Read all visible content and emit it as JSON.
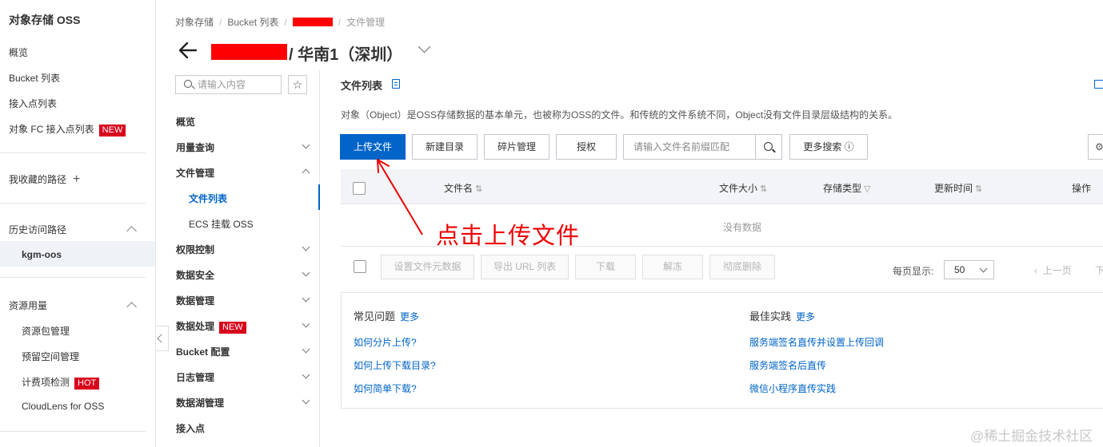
{
  "sidebar": {
    "title": "对象存储 OSS",
    "items": [
      {
        "label": "概览"
      },
      {
        "label": "Bucket 列表"
      },
      {
        "label": "接入点列表"
      },
      {
        "label": "对象 FC 接入点列表",
        "badge": "NEW"
      }
    ],
    "favorites_label": "我收藏的路径",
    "history_label": "历史访问路径",
    "history_items": [
      {
        "label": "kgm-oos"
      }
    ],
    "resources_label": "资源用量",
    "resource_items": [
      {
        "label": "资源包管理"
      },
      {
        "label": "预留空间管理"
      },
      {
        "label": "计费项检测",
        "badge": "HOT"
      },
      {
        "label": "CloudLens for OSS"
      }
    ]
  },
  "breadcrumb": {
    "items": [
      "对象存储",
      "Bucket 列表"
    ],
    "last": "文件管理"
  },
  "header": {
    "title": "/ 华南1（深圳）"
  },
  "subnav": {
    "search_placeholder": "请输入内容",
    "star": "☆",
    "items": [
      {
        "label": "概览"
      },
      {
        "label": "用量查询"
      },
      {
        "label": "文件管理"
      },
      {
        "label": "文件列表",
        "active": true
      },
      {
        "label": "ECS 挂载 OSS"
      },
      {
        "label": "权限控制"
      },
      {
        "label": "数据安全"
      },
      {
        "label": "数据管理"
      },
      {
        "label": "数据处理",
        "badge": "NEW"
      },
      {
        "label": "Bucket 配置"
      },
      {
        "label": "日志管理"
      },
      {
        "label": "数据湖管理"
      },
      {
        "label": "接入点"
      }
    ]
  },
  "main": {
    "section_title": "文件列表",
    "description": "对象（Object）是OSS存储数据的基本单元，也被称为OSS的文件。和传统的文件系统不同，Object没有文件目录层级结构的关系。",
    "toolbar": {
      "upload": "上传文件",
      "new_dir": "新建目录",
      "fragments": "碎片管理",
      "authorize": "授权",
      "filter_placeholder": "请输入文件名前缀匹配",
      "more_search": "更多搜索 ⓘ"
    },
    "table": {
      "columns": {
        "name": "文件名",
        "size": "文件大小",
        "storage": "存储类型",
        "updated": "更新时间",
        "ops": "操作"
      },
      "empty": "没有数据"
    },
    "bulk_actions": {
      "set_meta": "设置文件元数据",
      "export_url": "导出 URL 列表",
      "download": "下载",
      "unfreeze": "解冻",
      "delete": "彻底删除"
    },
    "pagination": {
      "per_page_label": "每页显示:",
      "per_page_value": "50",
      "prev": "上一页",
      "next_fragment": "下"
    },
    "help": {
      "faq_title": "常见问题",
      "faq_more": "更多",
      "faq_links": [
        "如何分片上传?",
        "如何上传下载目录?",
        "如何简单下载?"
      ],
      "best_title": "最佳实践",
      "best_more": "更多",
      "best_links": [
        "服务端签名直传并设置上传回调",
        "服务端签名后直传",
        "微信小程序直传实践"
      ]
    }
  },
  "annotation": {
    "text": "点击上传文件",
    "color": "#e00000"
  },
  "watermark": "@稀土掘金技术社区",
  "colors": {
    "primary": "#0064c8",
    "badge_red": "#d9001b"
  }
}
